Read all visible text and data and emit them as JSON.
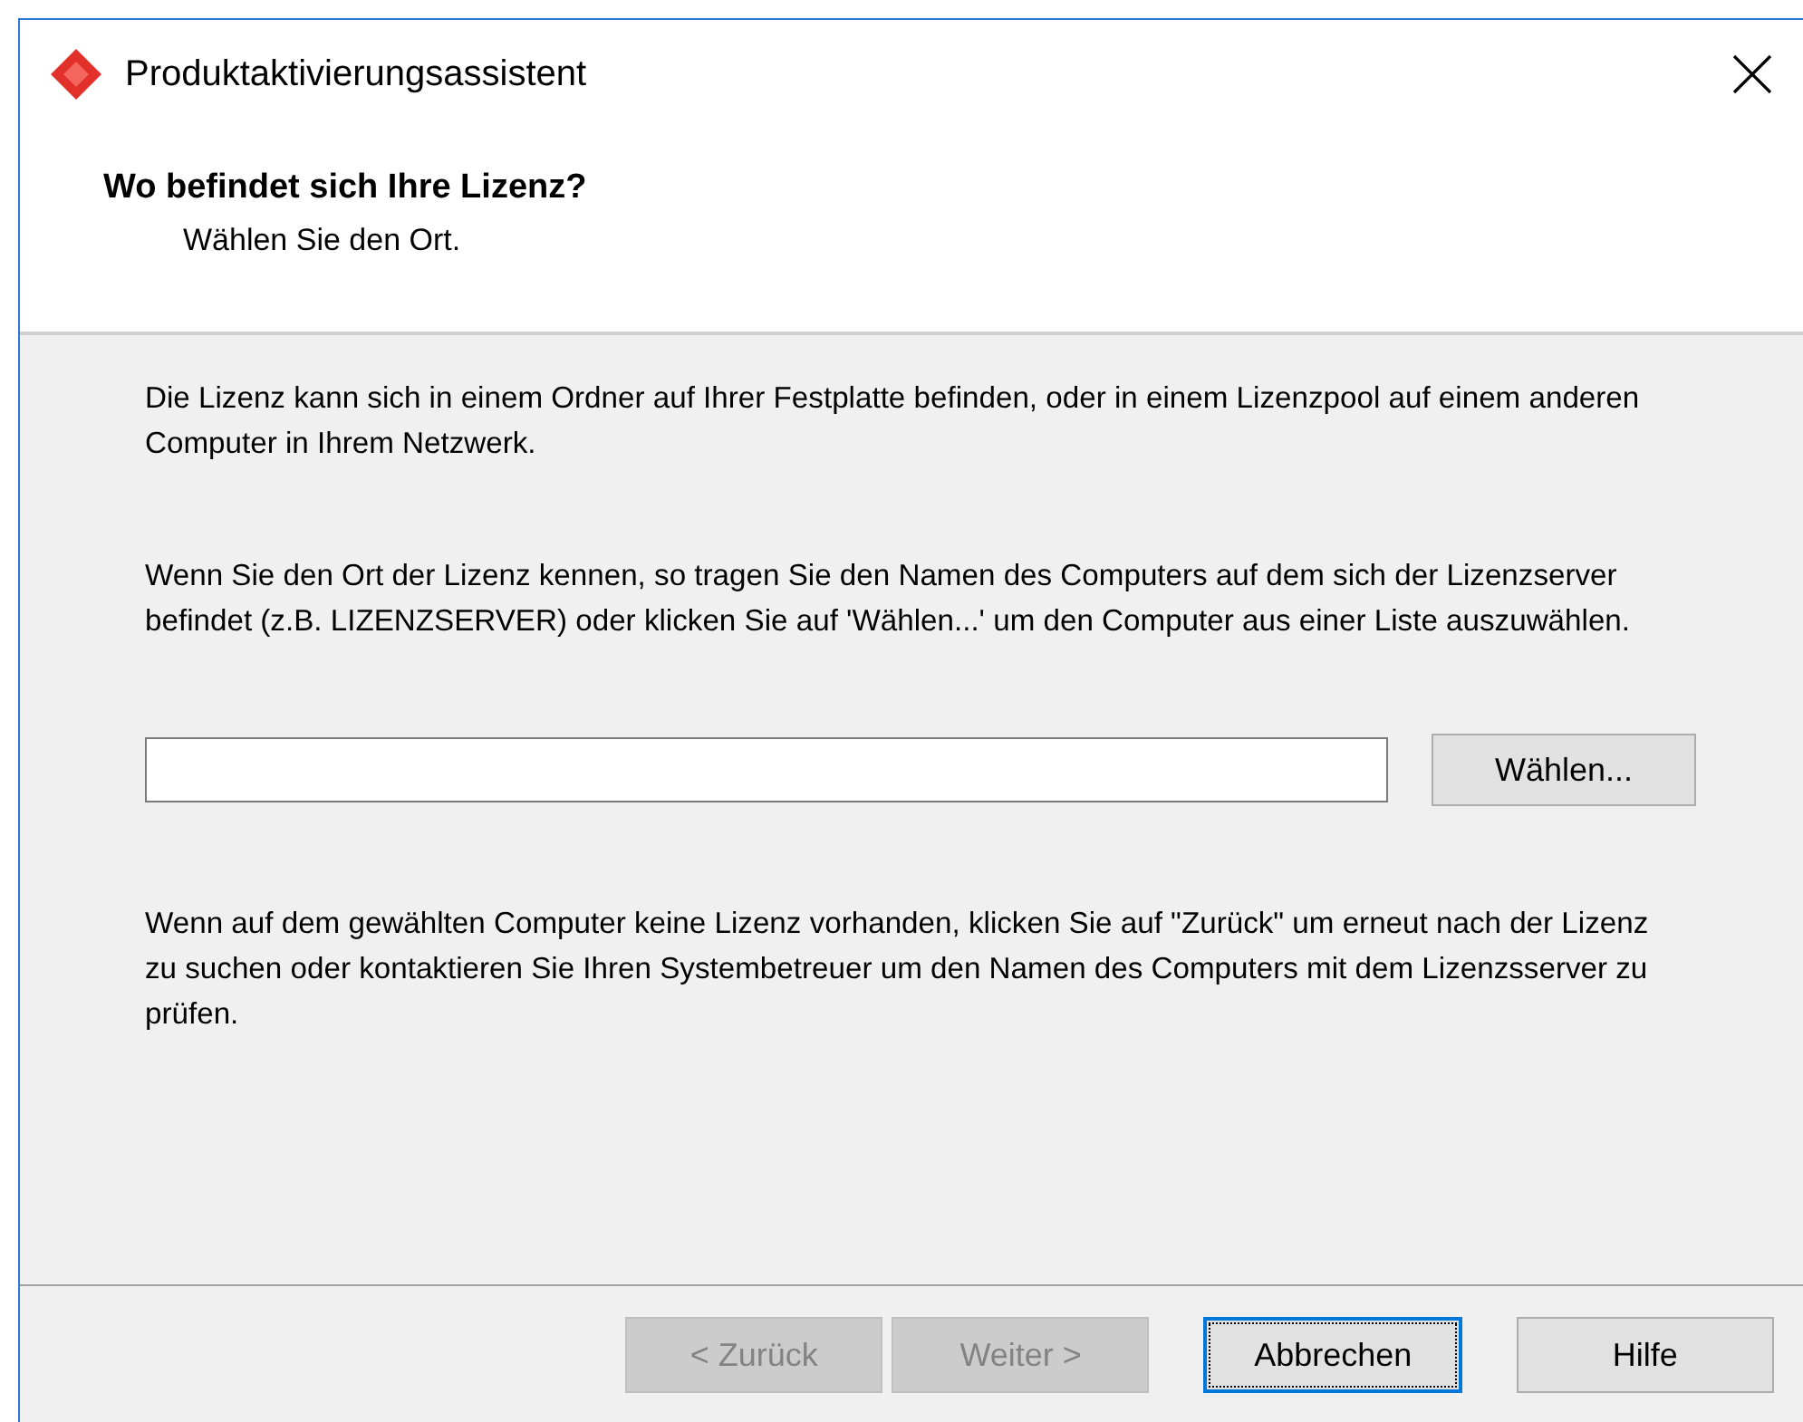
{
  "window": {
    "title": "Produktaktivierungsassistent"
  },
  "header": {
    "title": "Wo befindet sich Ihre Lizenz?",
    "subtitle": "Wählen Sie den Ort."
  },
  "intro": "Die Lizenz kann sich in einem Ordner auf Ihrer Festplatte befinden, oder in einem Lizenzpool auf einem anderen Computer in Ihrem Netzwerk.",
  "instructions": "Wenn Sie den Ort der Lizenz kennen, so tragen Sie  den Namen des Computers auf dem sich der Lizenzserver befindet (z.B. LIZENZSERVER) oder klicken Sie auf 'Wählen...' um den Computer aus einer Liste auszuwählen.",
  "computer_field": {
    "browse_button": "Wählen..."
  },
  "hint": "Wenn auf dem gewählten Computer keine Lizenz vorhanden, klicken Sie auf  \"Zurück\" um erneut nach der Lizenz zu suchen oder kontaktieren Sie Ihren Systembetreuer um den Namen des Computers mit dem Lizenzsserver zu prüfen.",
  "buttons": [
    {
      "label": "< Zurück",
      "disabled": true,
      "focused": false
    },
    {
      "label": "Weiter >",
      "disabled": true,
      "focused": false
    },
    {
      "label": "Abbrechen",
      "disabled": false,
      "focused": true
    },
    {
      "label": "Hilfe",
      "disabled": false,
      "focused": false
    }
  ]
}
